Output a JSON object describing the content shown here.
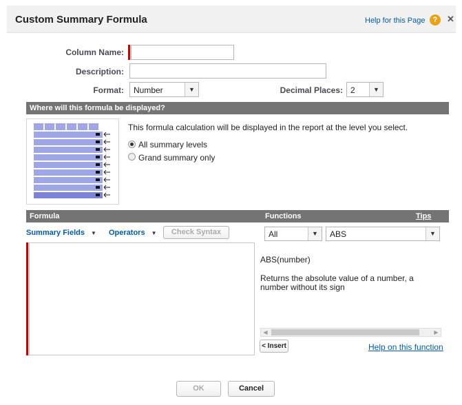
{
  "dialog": {
    "title": "Custom Summary Formula",
    "help_link": "Help for this Page",
    "help_icon": "?",
    "close_icon": "✕"
  },
  "form": {
    "column_name_label": "Column Name:",
    "column_name_value": "",
    "description_label": "Description:",
    "description_value": "",
    "format_label": "Format:",
    "format_value": "Number",
    "decimal_label": "Decimal Places:",
    "decimal_value": "2"
  },
  "display_section": {
    "header": "Where will this formula be displayed?",
    "intro": "This formula calculation will be displayed in the report at the level you select.",
    "options": [
      "All summary levels",
      "Grand summary only"
    ],
    "selected": "All summary levels"
  },
  "formula_section": {
    "header": "Formula",
    "summary_fields": "Summary Fields",
    "operators": "Operators",
    "check_syntax": "Check Syntax",
    "formula_value": ""
  },
  "functions_section": {
    "header": "Functions",
    "tips": "Tips",
    "category": "All",
    "function": "ABS",
    "signature": "ABS(number)",
    "description": "Returns the absolute value of a number, a number without its sign",
    "insert": "< Insert",
    "help_link": "Help on this function"
  },
  "buttons": {
    "ok": "OK",
    "cancel": "Cancel"
  },
  "colors": {
    "section_bar": "#747474",
    "link": "#015ba7",
    "required": "#cc0000",
    "diagram_fill": "#9fa6e6"
  },
  "icons": {
    "dropdown": "chevron-down-icon",
    "diagram_arrow": "left-arrow-icon"
  }
}
